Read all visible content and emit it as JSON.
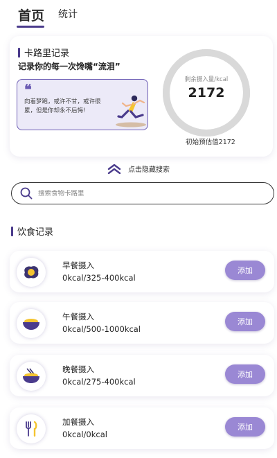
{
  "tabs": {
    "home": "首页",
    "stats": "统计"
  },
  "calorie_card": {
    "title": "卡路里记录",
    "slogan": "记录你的每一次馋嘴“流泪”",
    "quote_mark": "❝",
    "quote": "向着梦跑，或许不甘，或许很累，但是你却永不后悔!",
    "ring_label": "剩余摄入量/kcal",
    "ring_value": "2172",
    "ring_fraction": 1.0,
    "initial_estimate": "初始预估值2172"
  },
  "toggle_search": {
    "label": "点击隐藏搜索"
  },
  "search": {
    "placeholder": "搜索食物卡路里"
  },
  "diet": {
    "title": "饮食记录",
    "meals": [
      {
        "name": "早餐摄入",
        "kcal": "0kcal/325-400kcal",
        "icon": "fried-egg-icon",
        "button": "添加"
      },
      {
        "name": "午餐摄入",
        "kcal": "0kcal/500-1000kcal",
        "icon": "bowl-icon",
        "button": "添加"
      },
      {
        "name": "晚餐摄入",
        "kcal": "0kcal/275-400kcal",
        "icon": "noodle-bowl-icon",
        "button": "添加"
      },
      {
        "name": "加餐摄入",
        "kcal": "0kcal/0kcal",
        "icon": "fork-knife-icon",
        "button": "添加"
      }
    ]
  },
  "colors": {
    "accent": "#4a3b8c",
    "button": "#9a88d4",
    "ring": "#d9d9d9",
    "quote_bg": "#eceaf8"
  }
}
